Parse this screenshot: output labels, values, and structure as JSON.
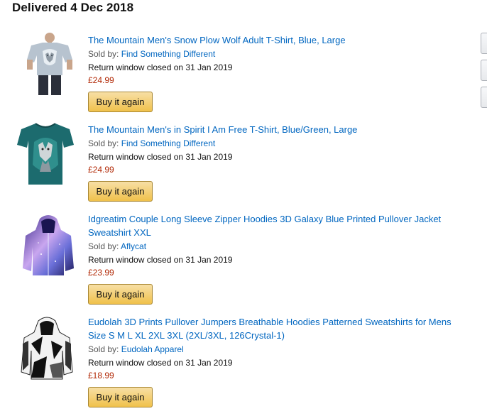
{
  "section": {
    "heading": "Delivered 4 Dec 2018"
  },
  "labels": {
    "sold_by": "Sold by:",
    "buy_again": "Buy it again"
  },
  "items": [
    {
      "title_line1": "The Mountain Men's Snow Plow Wolf Adult T-Shirt, Blue, Large",
      "title_line2": "",
      "seller": "Find Something Different",
      "return_text": "Return window closed on 31 Jan 2019",
      "price": "£24.99",
      "image_icon": "grey-wolf-tshirt-image"
    },
    {
      "title_line1": "The Mountain Men's in Spirit I Am Free T-Shirt, Blue/Green, Large",
      "title_line2": "",
      "seller": "Find Something Different",
      "return_text": "Return window closed on 31 Jan 2019",
      "price": "£24.99",
      "image_icon": "teal-wolf-tshirt-image"
    },
    {
      "title_line1": "Idgreatim Couple Long Sleeve Zipper Hoodies 3D Galaxy Blue Printed Pullover Jacket",
      "title_line2": "Sweatshirt XXL",
      "seller": "Aflycat",
      "return_text": "Return window closed on 31 Jan 2019",
      "price": "£23.99",
      "image_icon": "galaxy-hoodie-image"
    },
    {
      "title_line1": "Eudolah 3D Prints Pullover Jumpers Breathable Hoodies Patterned Sweatshirts for Mens",
      "title_line2": "Size S M L XL 2XL 3XL (2XL/3XL, 126Crystal-1)",
      "seller": "Eudolah Apparel",
      "return_text": "Return window closed on 31 Jan 2019",
      "price": "£18.99",
      "image_icon": "geometric-hoodie-image"
    }
  ],
  "colors": {
    "link": "#0066c0",
    "price": "#b12704",
    "button_top": "#f7dfa5",
    "button_bottom": "#f0c14b"
  }
}
